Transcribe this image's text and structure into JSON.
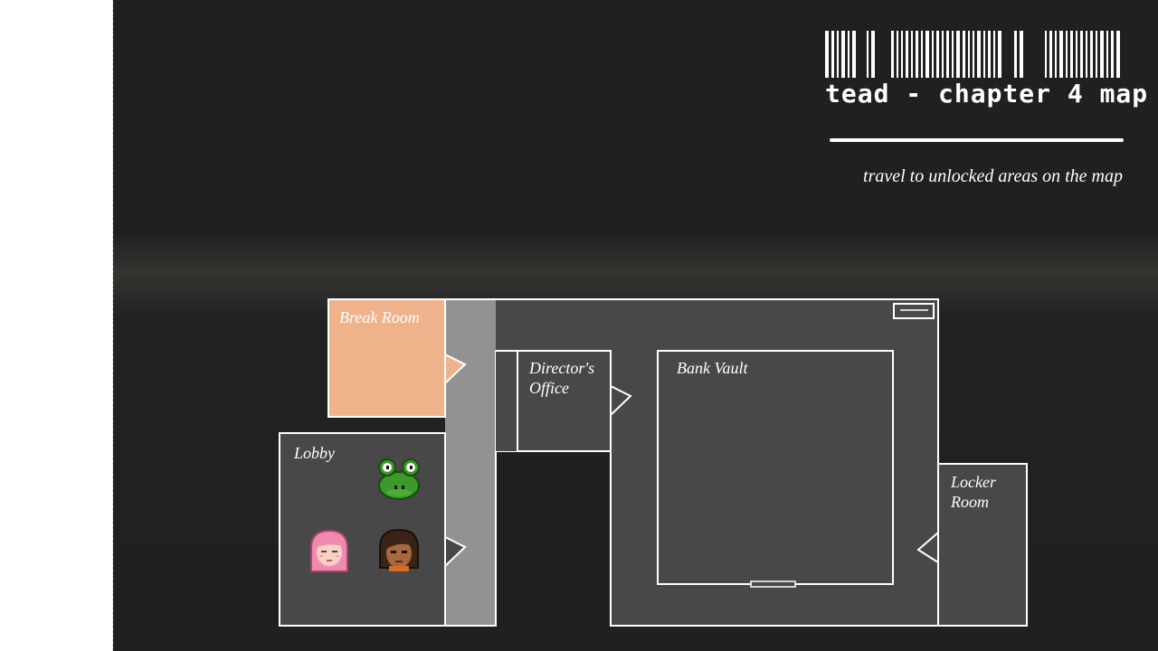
{
  "header": {
    "title": "tead - chapter 4 map",
    "subtitle": "travel to unlocked areas on the map"
  },
  "rooms": {
    "break_room": {
      "label": "Break Room",
      "state": "current"
    },
    "directors_office": {
      "label_line1": "Director's",
      "label_line2": "Office",
      "state": "unlocked"
    },
    "bank_vault": {
      "label": "Bank Vault",
      "state": "unlocked"
    },
    "lobby": {
      "label": "Lobby",
      "state": "unlocked"
    },
    "locker_room": {
      "label_line1": "Locker",
      "label_line2": "Room",
      "state": "unlocked"
    }
  },
  "characters": [
    {
      "name": "frog",
      "icon": "frog-avatar-icon",
      "room": "lobby"
    },
    {
      "name": "pink-haired girl",
      "icon": "pink-hair-avatar-icon",
      "room": "lobby"
    },
    {
      "name": "brown-haired girl",
      "icon": "brown-hair-avatar-icon",
      "room": "lobby"
    }
  ],
  "colors": {
    "background": "#202020",
    "room_fill": "#484848",
    "corridor_fill": "#929292",
    "current_room_fill": "#efb38c",
    "wall": "#ffffff"
  }
}
